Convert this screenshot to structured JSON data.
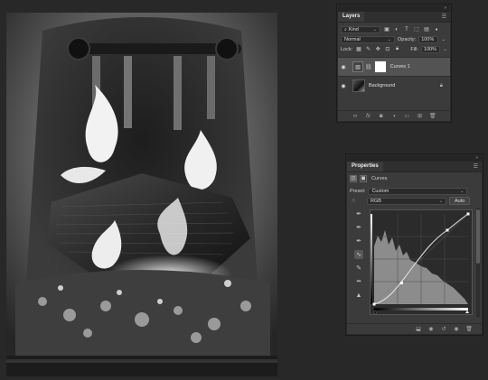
{
  "layers_panel": {
    "tab": "Layers",
    "filter": {
      "label": "Kind"
    },
    "blend_mode": "Normal",
    "opacity_label": "Opacity:",
    "opacity_value": "100%",
    "lock_label": "Lock:",
    "fill_label": "Fill:",
    "fill_value": "100%",
    "layers": [
      {
        "name": "Curves 1",
        "active": true
      },
      {
        "name": "Background",
        "active": false
      }
    ]
  },
  "properties_panel": {
    "tab": "Properties",
    "type_label": "Curves",
    "preset_label": "Preset:",
    "preset_value": "Custom",
    "channel_value": "RGB",
    "auto_label": "Auto"
  },
  "colors": {
    "panel_bg": "#3b3b3b",
    "workspace": "#282828",
    "active_layer": "#535353",
    "curve": "#e6e6e6",
    "histogram": "#8c8c8c"
  }
}
